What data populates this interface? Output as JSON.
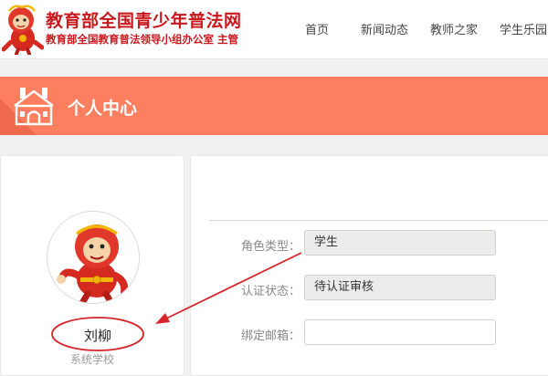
{
  "header": {
    "site_title": "教育部全国青少年普法网",
    "site_subtitle": "教育部全国教育普法领导小组办公室 主管",
    "logo_icon": "mascot-logo-icon",
    "nav": [
      {
        "label": "首页"
      },
      {
        "label": "新闻动态"
      },
      {
        "label": "教师之家"
      },
      {
        "label": "学生乐园"
      }
    ]
  },
  "banner": {
    "title": "个人中心",
    "icon": "building-icon",
    "color": "#fd7f5f"
  },
  "profile": {
    "name": "刘柳",
    "school": "系统学校",
    "avatar_icon": "mascot-avatar-icon"
  },
  "form": {
    "fields": [
      {
        "label": "角色类型：",
        "value": "学生"
      },
      {
        "label": "认证状态：",
        "value": "待认证审核"
      },
      {
        "label": "绑定邮箱：",
        "value": ""
      }
    ]
  },
  "annotation": {
    "color": "#d6242a",
    "shape": "arrow-to-circled-name"
  }
}
